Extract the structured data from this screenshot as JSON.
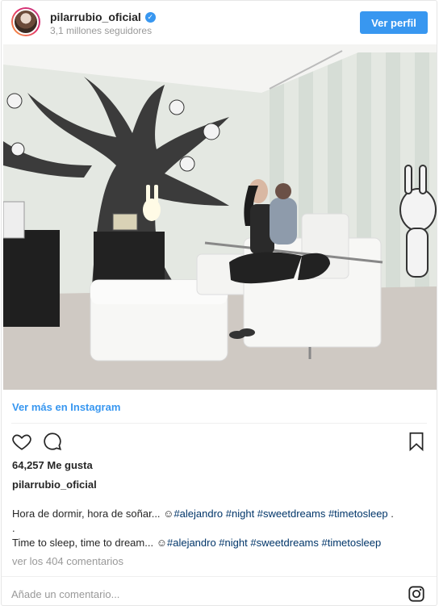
{
  "header": {
    "username": "pilarrubio_oficial",
    "verified_icon": "verified-badge-icon",
    "followers": "3,1 millones seguidores",
    "profile_button": "Ver perfil"
  },
  "photo": {
    "alt": "Mujer con bebé en sillón blanco en habitación infantil con mural de árbol"
  },
  "more_link": "Ver más en Instagram",
  "actions": {
    "like_icon": "heart-icon",
    "comment_icon": "comment-bubble-icon",
    "save_icon": "bookmark-icon"
  },
  "likes": "64,257 Me gusta",
  "author": "pilarrubio_oficial",
  "caption": {
    "line1_text": "Hora de dormir, hora de soñar... ",
    "line1_tags": "#alejandro #night #sweetdreams #timetosleep",
    "line1_end": " .",
    "line2": ".",
    "line3_text": "Time to sleep, time to dream... ",
    "line3_tags": "#alejandro #night #sweetdreams #timetosleep",
    "emoji": "☺"
  },
  "comments_link": "ver los 404 comentarios",
  "comment_placeholder": "Añade un comentario...",
  "brand_icon": "instagram-icon",
  "colors": {
    "accent": "#3897f0",
    "hashtag": "#003569",
    "muted": "#999999",
    "text": "#262626"
  }
}
